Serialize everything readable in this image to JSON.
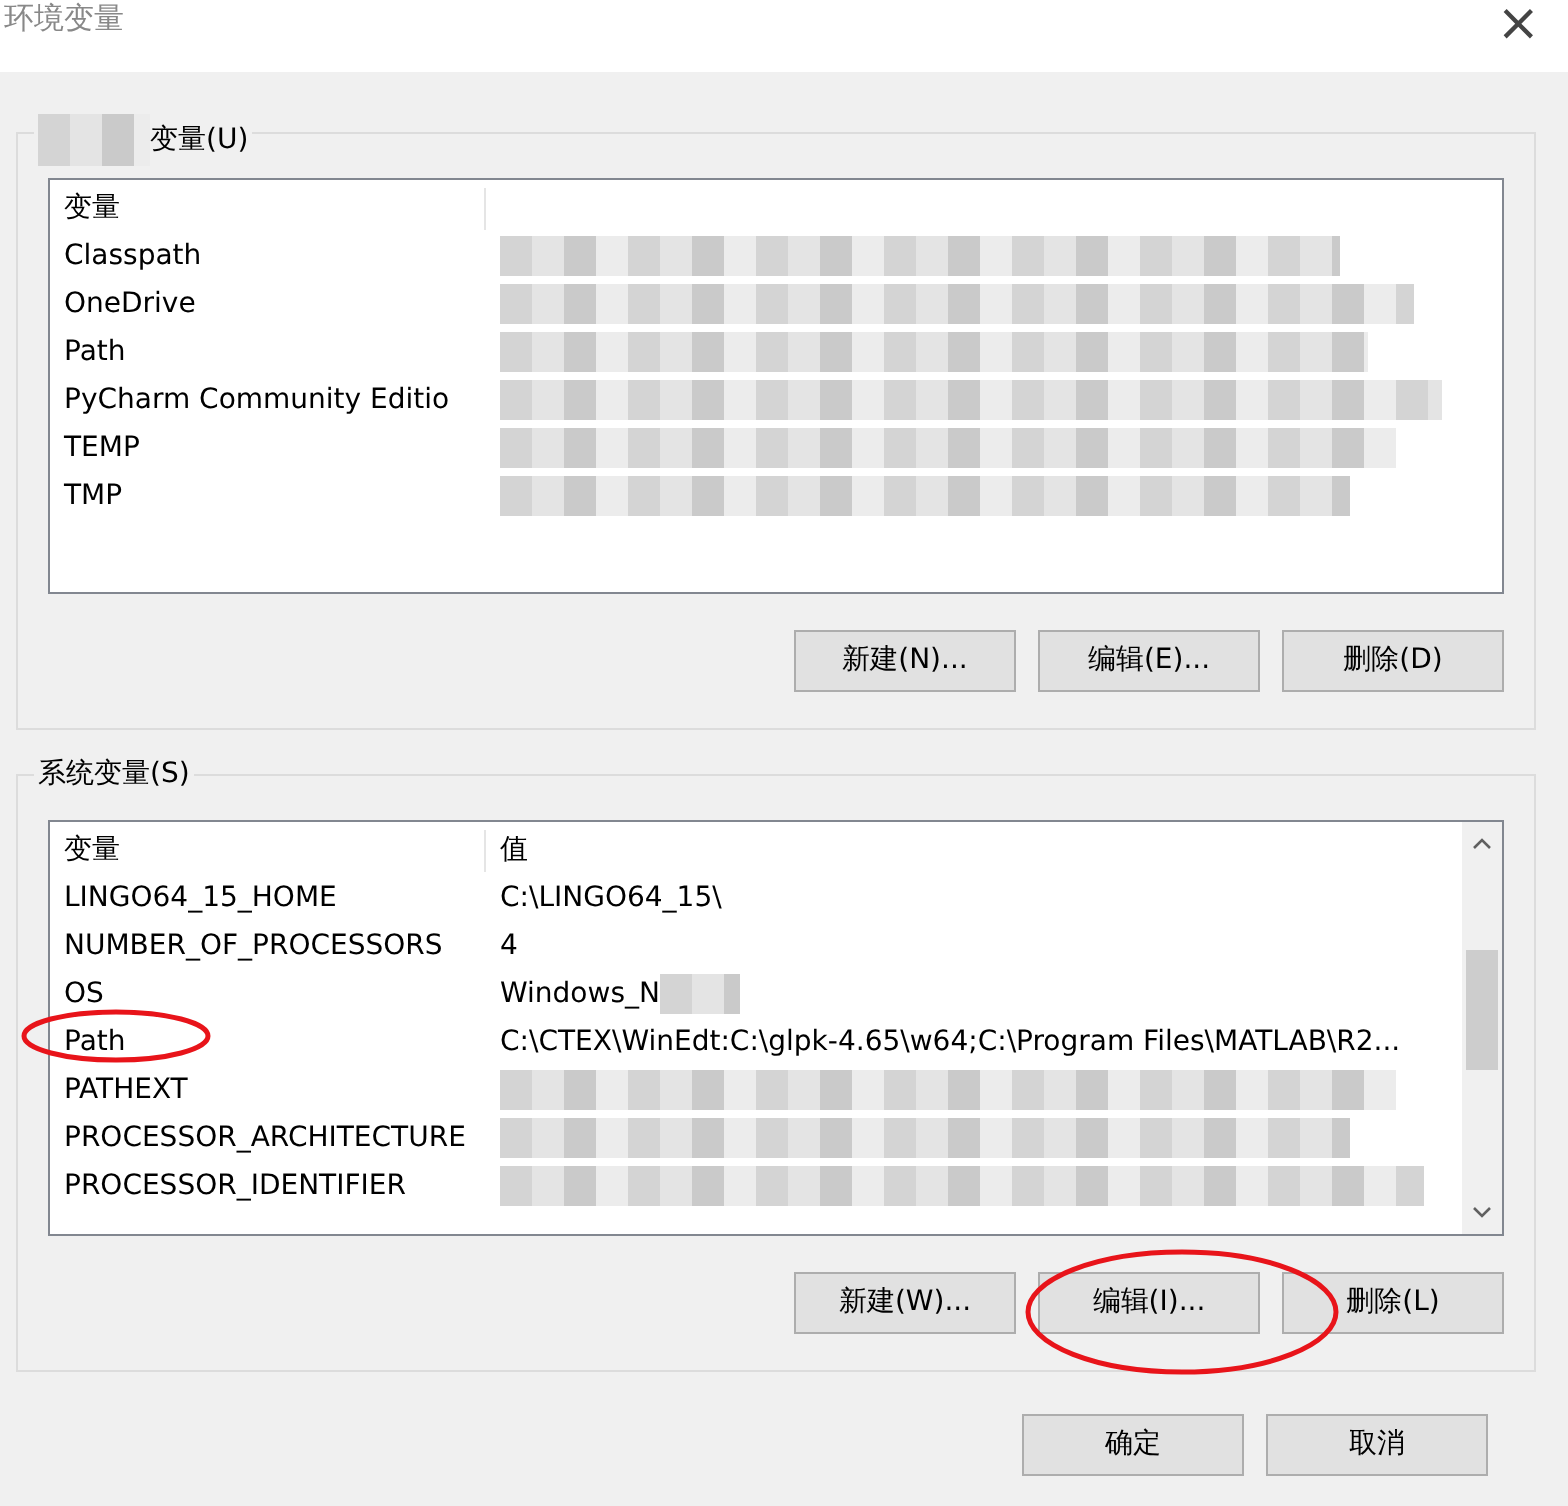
{
  "window": {
    "title": "环境变量",
    "close": "×"
  },
  "user_vars": {
    "label": "变量(U)",
    "label_redacted": true,
    "columns": [
      "变量"
    ],
    "scrollbar": false,
    "rows": [
      {
        "name": "Classpath",
        "value": "",
        "redacted": true
      },
      {
        "name": "OneDrive",
        "value": "",
        "redacted": true
      },
      {
        "name": "Path",
        "value": "",
        "redacted": true
      },
      {
        "name": "PyCharm Community Editio",
        "value": "",
        "redacted": true
      },
      {
        "name": "TEMP",
        "value": "",
        "redacted": true
      },
      {
        "name": "TMP",
        "value": "",
        "redacted": true
      }
    ],
    "buttons": [
      "新建(N)...",
      "编辑(E)...",
      "删除(D)"
    ]
  },
  "system_vars": {
    "label": "系统变量(S)",
    "label_redacted": false,
    "columns": [
      "变量",
      "值"
    ],
    "scrollbar": true,
    "rows": [
      {
        "name": "LINGO64_15_HOME",
        "value": "C:\\LINGO64_15\\",
        "redacted": false
      },
      {
        "name": "NUMBER_OF_PROCESSORS",
        "value": "4",
        "redacted": false
      },
      {
        "name": "OS",
        "value": "Windows_N",
        "redacted": true
      },
      {
        "name": "Path",
        "value": "C:\\CTEX\\WinEdt:C:\\glpk-4.65\\w64;C:\\Program Files\\MATLAB\\R2...",
        "redacted": false
      },
      {
        "name": "PATHEXT",
        "value": "",
        "redacted": true
      },
      {
        "name": "PROCESSOR_ARCHITECTURE",
        "value": "",
        "redacted": true
      },
      {
        "name": "PROCESSOR_IDENTIFIER",
        "value": "",
        "redacted": true
      }
    ],
    "buttons": [
      "新建(W)...",
      "编辑(I)...",
      "删除(L)"
    ]
  },
  "footer_buttons": [
    "确定",
    "取消"
  ]
}
